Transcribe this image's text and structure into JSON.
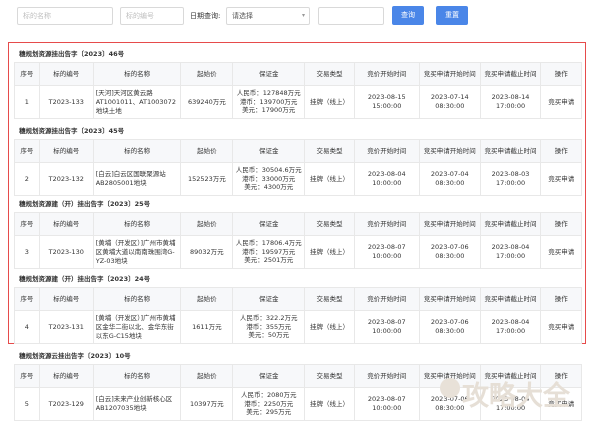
{
  "toolbar": {
    "name_placeholder": "标的名称",
    "code_placeholder": "标的编号",
    "date_label": "日期查询:",
    "date_select": "请选择",
    "search_button": "查询",
    "reset_button": "重置"
  },
  "headers": [
    "序号",
    "标的编号",
    "标的名称",
    "起始价",
    "保证金",
    "交易类型",
    "竞价开始时间",
    "竞买申请开始时间",
    "竞买申请截止时间",
    "操作"
  ],
  "blocks": [
    {
      "title": "穗规划资源挂出告字〔2023〕46号",
      "row": {
        "no": "1",
        "code": "T2023-133",
        "name": "[天河]天河区黄云路AT1001011、AT1003072地块土地",
        "price": "639240万元",
        "deposit": [
          "人民币：127848万元",
          "港币：139700万元",
          "美元：17900万元"
        ],
        "type": "挂牌（线上）",
        "bid_start": [
          "2023-08-15",
          "15:00:00"
        ],
        "apply_start": [
          "2023-07-14",
          "08:30:00"
        ],
        "apply_end": [
          "2023-08-14",
          "17:00:00"
        ],
        "action": "竞买申请"
      }
    },
    {
      "title": "穗规划资源挂出告字〔2023〕45号",
      "row": {
        "no": "2",
        "code": "T2023-132",
        "name": "[白云]白云区国联聚源站AB2805001地块",
        "price": "152523万元",
        "deposit": [
          "人民币：30504.6万元",
          "港币：33000万元",
          "美元：4300万元"
        ],
        "type": "挂牌（线上）",
        "bid_start": [
          "2023-08-04",
          "10:00:00"
        ],
        "apply_start": [
          "2023-07-04",
          "08:30:00"
        ],
        "apply_end": [
          "2023-08-03",
          "17:00:00"
        ],
        "action": "竞买申请"
      }
    },
    {
      "title": "穗规划资源建（开）挂出告字〔2023〕25号",
      "row": {
        "no": "3",
        "code": "T2023-130",
        "name": "[黄埔（开发区）]广州市黄埔区黄埔大道以南南珠围湾G-YZ-03地块",
        "price": "89032万元",
        "deposit": [
          "人民币：17806.4万元",
          "港币：19597万元",
          "美元：2501万元"
        ],
        "type": "挂牌（线上）",
        "bid_start": [
          "2023-08-07",
          "10:00:00"
        ],
        "apply_start": [
          "2023-07-06",
          "08:30:00"
        ],
        "apply_end": [
          "2023-08-04",
          "17:00:00"
        ],
        "action": "竞买申请"
      }
    },
    {
      "title": "穗规划资源建（开）挂出告字〔2023〕24号",
      "row": {
        "no": "4",
        "code": "T2023-131",
        "name": "[黄埔（开发区）]广州市黄埔区金华二街以北、金华东街以东G-C15地块",
        "price": "1611万元",
        "deposit": [
          "人民币：322.2万元",
          "港币：355万元",
          "美元：50万元"
        ],
        "type": "挂牌（线上）",
        "bid_start": [
          "2023-08-07",
          "10:00:00"
        ],
        "apply_start": [
          "2023-07-06",
          "08:30:00"
        ],
        "apply_end": [
          "2023-08-04",
          "17:00:00"
        ],
        "action": "竞买申请"
      }
    },
    {
      "title": "穗规划资源云挂出告字〔2023〕10号",
      "row": {
        "no": "5",
        "code": "T2023-129",
        "name": "[白云]未来产业创新核心区AB1207035地块",
        "price": "10397万元",
        "deposit": [
          "人民币：2080万元",
          "港币：2250万元",
          "美元：295万元"
        ],
        "type": "挂牌（线上）",
        "bid_start": [
          "2023-08-07",
          "10:00:00"
        ],
        "apply_start": [
          "2023-07-06",
          "08:30:00"
        ],
        "apply_end": [
          "2023-08-04",
          "17:00:00"
        ],
        "action": "竞买申请"
      }
    }
  ],
  "watermark": "攻略大全"
}
